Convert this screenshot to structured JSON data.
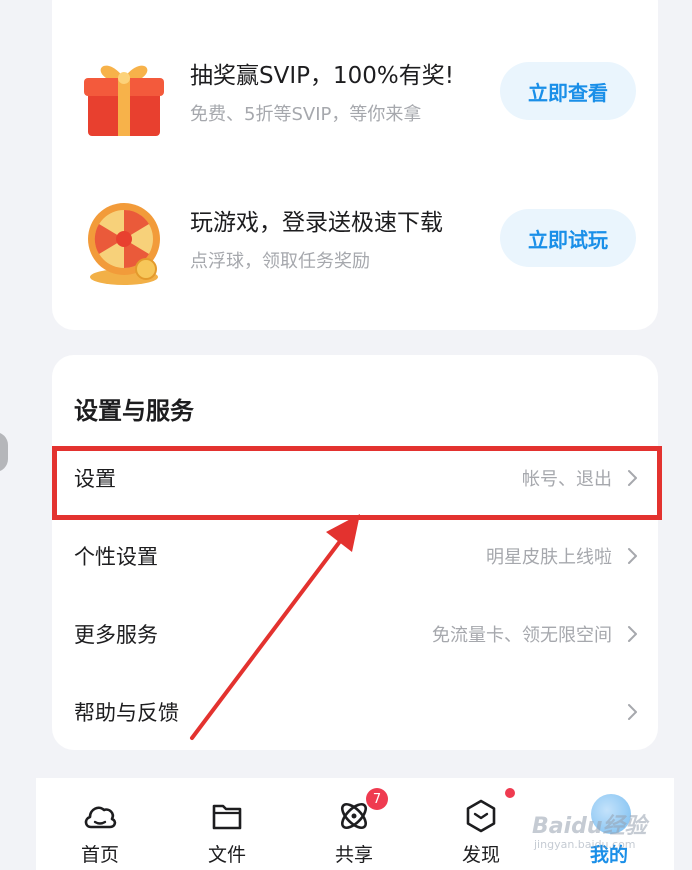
{
  "promos": [
    {
      "title": "抽奖赢SVIP，100%有奖!",
      "subtitle": "免费、5折等SVIP，等你来拿",
      "button": "立即查看",
      "icon": "gift-box-icon"
    },
    {
      "title": "玩游戏，登录送极速下载",
      "subtitle": "点浮球，领取任务奖励",
      "button": "立即试玩",
      "icon": "prize-wheel-icon"
    }
  ],
  "settings_section": {
    "title": "设置与服务",
    "rows": [
      {
        "label": "设置",
        "value": "帐号、退出",
        "highlighted": true
      },
      {
        "label": "个性设置",
        "value": "明星皮肤上线啦"
      },
      {
        "label": "更多服务",
        "value": "免流量卡、领无限空间"
      },
      {
        "label": "帮助与反馈",
        "value": ""
      }
    ]
  },
  "bottom_nav": {
    "items": [
      {
        "label": "首页",
        "icon": "cloud-home-icon"
      },
      {
        "label": "文件",
        "icon": "folder-icon"
      },
      {
        "label": "共享",
        "icon": "share-atom-icon",
        "badge": "7"
      },
      {
        "label": "发现",
        "icon": "discover-cube-icon",
        "dot": true
      },
      {
        "label": "我的",
        "icon": "profile-avatar-icon",
        "active": true
      }
    ]
  },
  "watermark": {
    "text": "Baidu经验",
    "sub": "jingyan.baidu.com"
  },
  "colors": {
    "accent": "#1a8fe8",
    "highlight": "#e3322f",
    "badge": "#ef3b50",
    "background": "#f2f3f7"
  }
}
